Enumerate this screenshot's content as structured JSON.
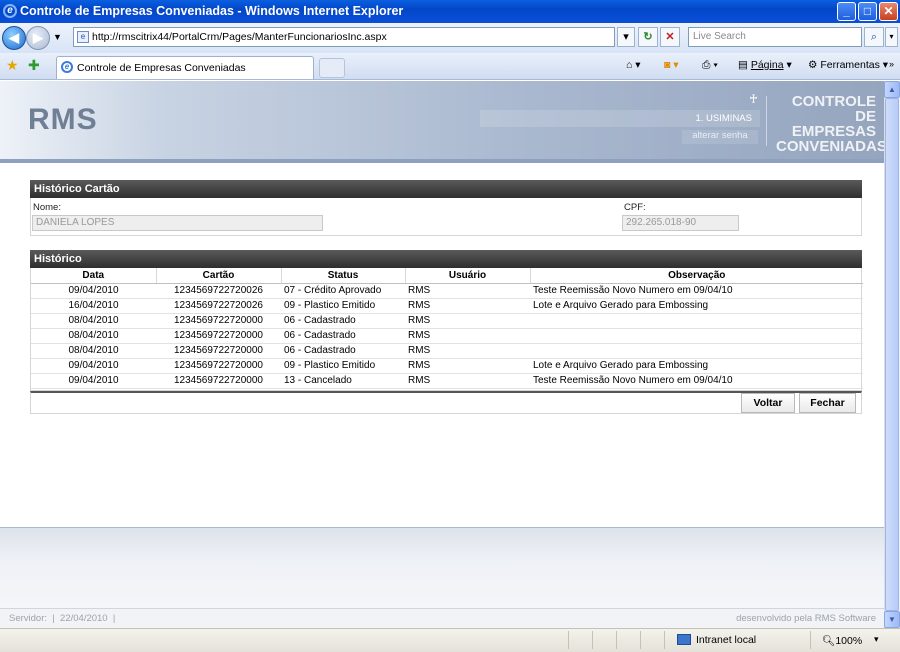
{
  "window": {
    "title": "Controle de Empresas Conveniadas - Windows Internet Explorer",
    "minimize": "_",
    "maximize": "□",
    "close": "✕"
  },
  "browser": {
    "url": "http://rmscitrix44/PortalCrm/Pages/ManterFuncionariosInc.aspx",
    "search_placeholder": "Live Search",
    "tab_title": "Controle de Empresas Conveniadas",
    "page_menu": "Página",
    "tools_menu": "Ferramentas"
  },
  "header": {
    "logo": "RMS",
    "company": "1. USIMINAS",
    "change_password": "alterar senha",
    "brand_lines": [
      "CONTROLE",
      "DE EMPRESAS",
      "CONVENIADAS"
    ]
  },
  "card_section": {
    "title": "Histórico Cartão",
    "name_label": "Nome:",
    "name_value": "DANIELA LOPES",
    "cpf_label": "CPF:",
    "cpf_value": "292.265.018-90"
  },
  "history_section": {
    "title": "Histórico",
    "columns": [
      "Data",
      "Cartão",
      "Status",
      "Usuário",
      "Observação"
    ],
    "rows": [
      [
        "09/04/2010",
        "1234569722720026",
        "07 - Crédito Aprovado",
        "RMS",
        "Teste Reemissão Novo Numero em 09/04/10"
      ],
      [
        "16/04/2010",
        "1234569722720026",
        "09 - Plastico Emitido",
        "RMS",
        "Lote e Arquivo Gerado para Embossing"
      ],
      [
        "08/04/2010",
        "1234569722720000",
        "06 - Cadastrado",
        "RMS",
        ""
      ],
      [
        "08/04/2010",
        "1234569722720000",
        "06 - Cadastrado",
        "RMS",
        ""
      ],
      [
        "08/04/2010",
        "1234569722720000",
        "06 - Cadastrado",
        "RMS",
        ""
      ],
      [
        "09/04/2010",
        "1234569722720000",
        "09 - Plastico Emitido",
        "RMS",
        "Lote e Arquivo Gerado para Embossing"
      ],
      [
        "09/04/2010",
        "1234569722720000",
        "13 - Cancelado",
        "RMS",
        "Teste Reemissão Novo Numero em 09/04/10"
      ]
    ],
    "back_button": "Voltar",
    "close_button": "Fechar"
  },
  "footer": {
    "server_text": "Servidor:  |  22/04/2010  |",
    "developer": "desenvolvido pela RMS Software"
  },
  "status_bar": {
    "zone": "Intranet local",
    "zoom": "100%"
  }
}
